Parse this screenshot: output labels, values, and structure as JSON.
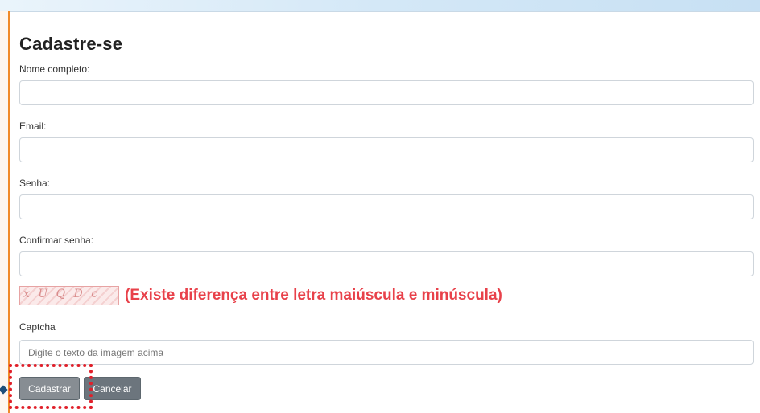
{
  "form": {
    "title": "Cadastre-se",
    "full_name_label": "Nome completo:",
    "full_name_value": "",
    "email_label": "Email:",
    "email_value": "",
    "password_label": "Senha:",
    "password_value": "",
    "confirm_password_label": "Confirmar senha:",
    "confirm_password_value": "",
    "captcha_image_text": "x U Q D c",
    "captcha_note": "(Existe diferença entre letra maiúscula e minúscula)",
    "captcha_label": "Captcha",
    "captcha_placeholder": "Digite o texto da imagem acima",
    "captcha_value": "",
    "submit_label": "Cadastrar",
    "cancel_label": "Cancelar"
  },
  "colors": {
    "accent_bar": "#f08a2a",
    "note_text": "#e8414a",
    "highlight_border": "#e0202a",
    "submit_button": "#878d93",
    "cancel_button": "#6c757d"
  }
}
